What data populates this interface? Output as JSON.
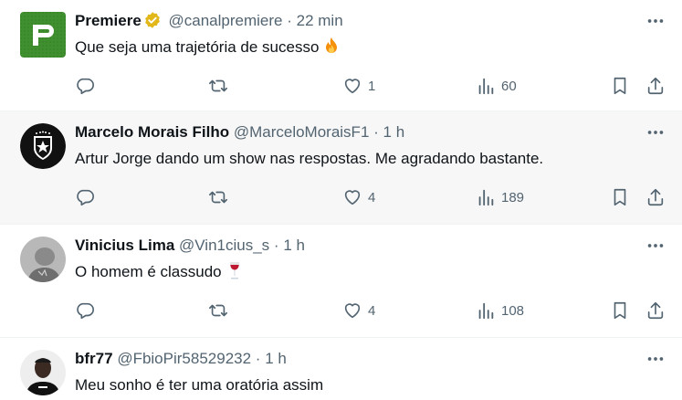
{
  "tweets": [
    {
      "name": "Premiere",
      "handle": "@canalpremiere",
      "separator": "·",
      "time": "22 min",
      "text": "Que seja uma trajetória de sucesso",
      "emoji": "fire",
      "replies": "",
      "retweets": "",
      "likes": "1",
      "views": "60",
      "avatar_icon": "premiere-logo-icon",
      "verified": true
    },
    {
      "name": "Marcelo Morais Filho",
      "handle": "@MarceloMoraisF1",
      "separator": "·",
      "time": "1 h",
      "text": "Artur Jorge dando um show nas respostas. Me agradando bastante.",
      "replies": "",
      "retweets": "",
      "likes": "4",
      "views": "189",
      "avatar_icon": "botafogo-crest-icon"
    },
    {
      "name": "Vinicius Lima",
      "handle": "@Vin1cius_s",
      "separator": "·",
      "time": "1 h",
      "text": "O homem é classudo",
      "emoji": "wine-glass",
      "replies": "",
      "retweets": "",
      "likes": "4",
      "views": "108",
      "avatar_icon": "user-photo-icon"
    },
    {
      "name": "bfr77",
      "handle": "@FbioPir58529232",
      "separator": "·",
      "time": "1 h",
      "text": "Meu sonho é ter uma oratória assim",
      "avatar_icon": "user-photo-icon"
    }
  ],
  "colors": {
    "text": "#0f1419",
    "muted": "#536471",
    "highlight_bg": "#f7f7f7",
    "verified_gold": "#e2b719",
    "premiere_green": "#3f8f2f"
  }
}
